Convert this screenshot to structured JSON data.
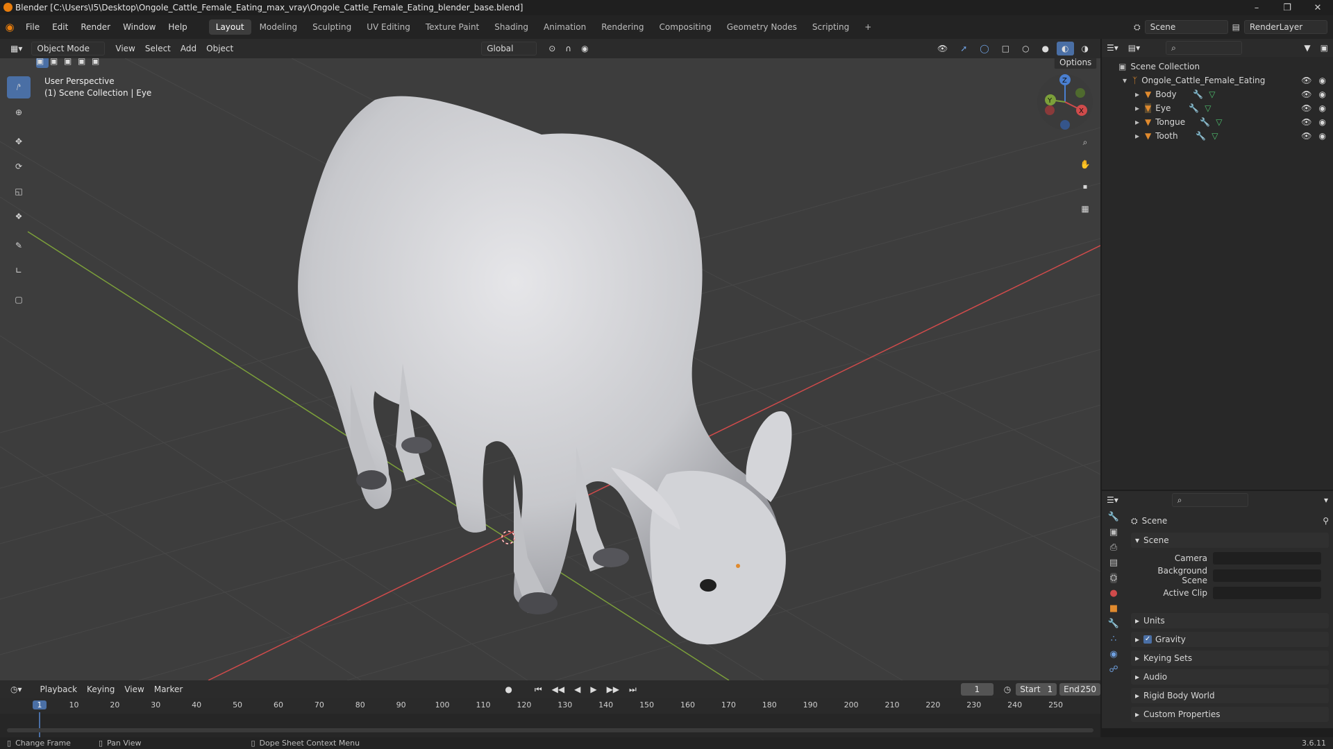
{
  "window": {
    "title": "Blender [C:\\Users\\I5\\Desktop\\Ongole_Cattle_Female_Eating_max_vray\\Ongole_Cattle_Female_Eating_blender_base.blend]"
  },
  "menus": [
    "File",
    "Edit",
    "Render",
    "Window",
    "Help"
  ],
  "workspaces": [
    "Layout",
    "Modeling",
    "Sculpting",
    "UV Editing",
    "Texture Paint",
    "Shading",
    "Animation",
    "Rendering",
    "Compositing",
    "Geometry Nodes",
    "Scripting"
  ],
  "active_workspace": "Layout",
  "scene_selector": {
    "scene": "Scene",
    "view_layer": "RenderLayer"
  },
  "viewport_header": {
    "mode": "Object Mode",
    "menus": [
      "View",
      "Select",
      "Add",
      "Object"
    ],
    "transform_orientation": "Global",
    "options_label": "Options"
  },
  "viewport": {
    "perspective_label": "User Perspective",
    "context_label": "(1) Scene Collection | Eye",
    "gizmo_axes": [
      "X",
      "Y",
      "Z"
    ]
  },
  "outliner": {
    "root": "Scene Collection",
    "collection": "Ongole_Cattle_Female_Eating",
    "objects": [
      "Body",
      "Eye",
      "Tongue",
      "Tooth"
    ]
  },
  "properties": {
    "context": "Scene",
    "panel": "Scene",
    "fields": [
      {
        "label": "Camera",
        "value": ""
      },
      {
        "label": "Background Scene",
        "value": ""
      },
      {
        "label": "Active Clip",
        "value": ""
      }
    ],
    "sections": [
      "Units",
      "Gravity",
      "Keying Sets",
      "Audio",
      "Rigid Body World",
      "Custom Properties"
    ],
    "gravity_checked": true
  },
  "timeline": {
    "menus": [
      "Playback",
      "Keying",
      "View",
      "Marker"
    ],
    "current_frame": "1",
    "start_label": "Start",
    "start": "1",
    "end_label": "End",
    "end": "250",
    "ticks": [
      "1",
      "10",
      "20",
      "30",
      "40",
      "50",
      "60",
      "70",
      "80",
      "90",
      "100",
      "110",
      "120",
      "130",
      "140",
      "150",
      "160",
      "170",
      "180",
      "190",
      "200",
      "210",
      "220",
      "230",
      "240",
      "250"
    ]
  },
  "statusbar": {
    "items": [
      "Change Frame",
      "Pan View",
      "Dope Sheet Context Menu"
    ],
    "version": "3.6.11"
  },
  "colors": {
    "accent": "#4a6fa5",
    "x_axis": "#d04b4b",
    "y_axis": "#7ca03a",
    "z_axis": "#4a7fd0",
    "object_icon": "#e08a2e"
  }
}
